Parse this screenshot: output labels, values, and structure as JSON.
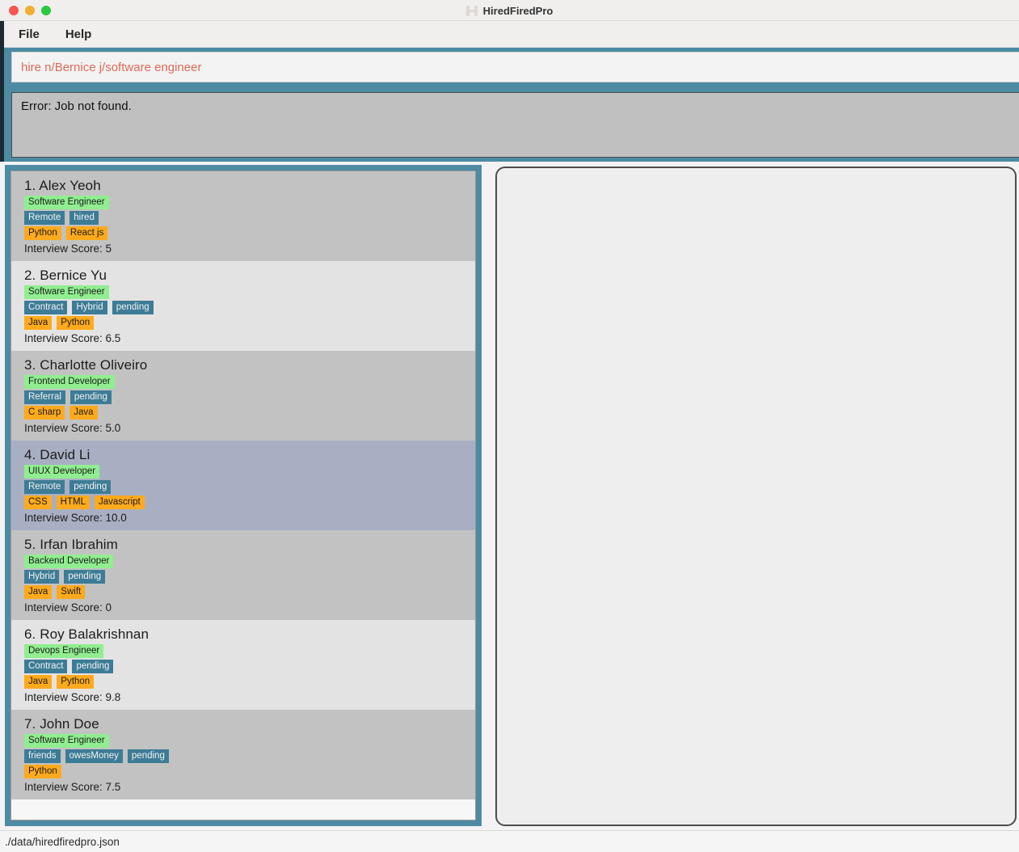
{
  "window": {
    "title": "HiredFiredPro",
    "icon": "app-logo-icon",
    "traffic_lights": {
      "close": "close-button",
      "minimize": "minimize-button",
      "maximize": "maximize-button"
    }
  },
  "menubar": {
    "items": [
      {
        "label": "File"
      },
      {
        "label": "Help"
      }
    ]
  },
  "command_box": {
    "value": "hire n/Bernice j/software engineer",
    "placeholder": "Enter command here...",
    "text_color": "#dd6a58"
  },
  "result_box": {
    "message": "Error: Job not found."
  },
  "person_list": {
    "persons": [
      {
        "index": "1.",
        "name": "Alex Yeoh",
        "job": "Software Engineer",
        "meta_tags": [
          "Remote",
          "hired"
        ],
        "skills": [
          "Python",
          "React js"
        ],
        "score_label": "Interview Score: 5",
        "selected": false
      },
      {
        "index": "2.",
        "name": "Bernice Yu",
        "job": "Software Engineer",
        "meta_tags": [
          "Contract",
          "Hybrid",
          "pending"
        ],
        "skills": [
          "Java",
          "Python"
        ],
        "score_label": "Interview Score: 6.5",
        "selected": false
      },
      {
        "index": "3.",
        "name": "Charlotte Oliveiro",
        "job": "Frontend Developer",
        "meta_tags": [
          "Referral",
          "pending"
        ],
        "skills": [
          "C sharp",
          "Java"
        ],
        "score_label": "Interview Score: 5.0",
        "selected": false
      },
      {
        "index": "4.",
        "name": "David Li",
        "job": "UIUX Developer",
        "meta_tags": [
          "Remote",
          "pending"
        ],
        "skills": [
          "CSS",
          "HTML",
          "Javascript"
        ],
        "score_label": "Interview Score: 10.0",
        "selected": true
      },
      {
        "index": "5.",
        "name": "Irfan Ibrahim",
        "job": "Backend Developer",
        "meta_tags": [
          "Hybrid",
          "pending"
        ],
        "skills": [
          "Java",
          "Swift"
        ],
        "score_label": "Interview Score: 0",
        "selected": false
      },
      {
        "index": "6.",
        "name": "Roy Balakrishnan",
        "job": "Devops Engineer",
        "meta_tags": [
          "Contract",
          "pending"
        ],
        "skills": [
          "Java",
          "Python"
        ],
        "score_label": "Interview Score: 9.8",
        "selected": false
      },
      {
        "index": "7.",
        "name": "John Doe",
        "job": "Software Engineer",
        "meta_tags": [
          "friends",
          "owesMoney",
          "pending"
        ],
        "skills": [
          "Python"
        ],
        "score_label": "Interview Score: 7.5",
        "selected": false
      }
    ]
  },
  "detail_panel": {
    "content": ""
  },
  "statusbar": {
    "path": "./data/hiredfiredpro.json"
  },
  "colors": {
    "accent_teal": "#4d8ba3",
    "job_tag": "#90ee90",
    "meta_tag": "#3d7c96",
    "skill_tag": "#ffaa1d",
    "selected_row": "#a9afc3",
    "row_even": "#e3e3e3",
    "row_odd": "#c2c2c2",
    "error_text": "#dd6a58"
  }
}
